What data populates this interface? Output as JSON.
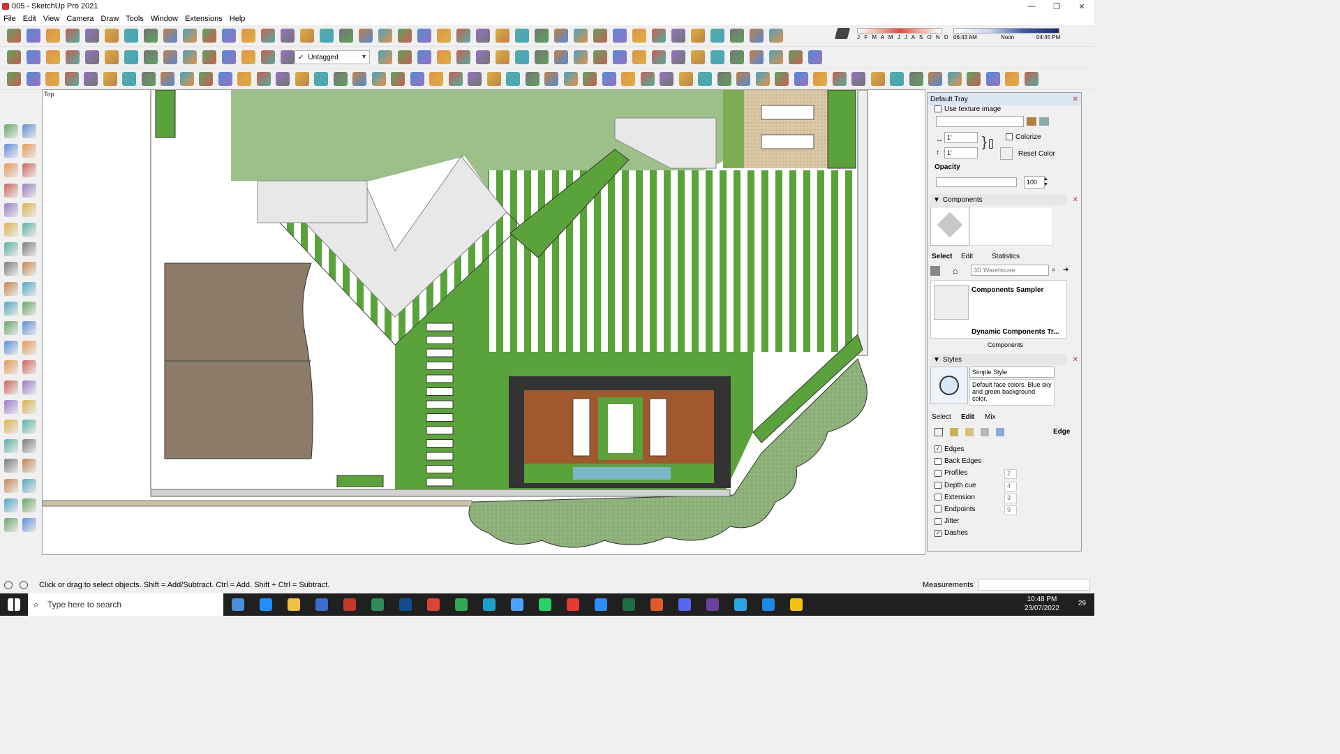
{
  "window": {
    "title": "005 - SketchUp Pro 2021",
    "minimize": "—",
    "restore": "❐",
    "close": "✕"
  },
  "menu": [
    "File",
    "Edit",
    "View",
    "Camera",
    "Draw",
    "Tools",
    "Window",
    "Extensions",
    "Help"
  ],
  "tag_selector": {
    "check": "✓",
    "value": "Untagged"
  },
  "shadow": {
    "months": "J F M A M J J A S O N D",
    "time_start": "06:43 AM",
    "time_mid": "Noon",
    "time_end": "04:45 PM"
  },
  "viewport": {
    "label": "Top"
  },
  "tray": {
    "title": "Default Tray",
    "use_texture": "Use texture image",
    "size_w": "1'",
    "size_h": "1'",
    "colorize": "Colorize",
    "reset_color": "Reset Color",
    "opacity_label": "Opacity",
    "opacity_value": "100",
    "components": {
      "header": "Components",
      "tabs": [
        "Select",
        "Edit",
        "Statistics"
      ],
      "search_placeholder": "3D Warehouse",
      "items": [
        "Components Sampler",
        "Dynamic Components Tr..."
      ],
      "footer": "Components"
    },
    "styles": {
      "header": "Styles",
      "style_name": "Simple Style",
      "style_desc": "Default face colors. Blue sky and green background color.",
      "tabs": [
        "Select",
        "Edit",
        "Mix"
      ],
      "edge_label": "Edge",
      "settings": [
        {
          "label": "Edges",
          "checked": true,
          "value": ""
        },
        {
          "label": "Back Edges",
          "checked": false,
          "value": ""
        },
        {
          "label": "Profiles",
          "checked": false,
          "value": "2"
        },
        {
          "label": "Depth cue",
          "checked": false,
          "value": "4"
        },
        {
          "label": "Extension",
          "checked": false,
          "value": "3"
        },
        {
          "label": "Endpoints",
          "checked": false,
          "value": "9"
        },
        {
          "label": "Jitter",
          "checked": false,
          "value": ""
        },
        {
          "label": "Dashes",
          "checked": true,
          "value": ""
        }
      ]
    }
  },
  "status": {
    "message": "Click or drag to select objects. Shift = Add/Subtract. Ctrl = Add. Shift + Ctrl = Subtract.",
    "measurements": "Measurements"
  },
  "taskbar": {
    "search": "Type here to search",
    "time": "10:48 PM",
    "date": "23/07/2022",
    "notifications": "29"
  },
  "colors": {
    "grass_dark": "#5aa33a",
    "grass_light": "#9dc08b",
    "paving": "#8b7b68",
    "deck": "#a0582c",
    "tray_header": "#dbe6f5"
  }
}
